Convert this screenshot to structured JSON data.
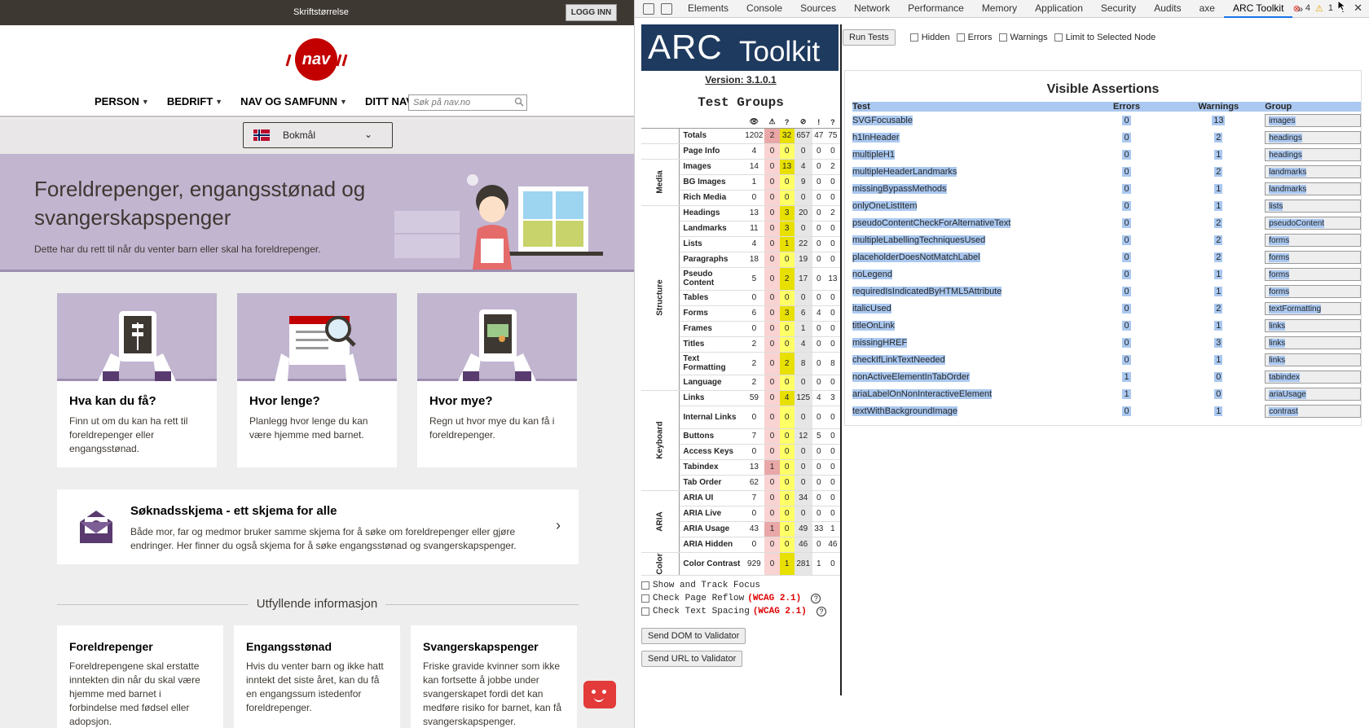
{
  "site": {
    "topbar": {
      "fontsize_label": "Skriftstørrelse",
      "login_label": "LOGG INN"
    },
    "menu": [
      {
        "label": "PERSON"
      },
      {
        "label": "BEDRIFT"
      },
      {
        "label": "NAV OG SAMFUNN"
      },
      {
        "label": "DITT NAV"
      }
    ],
    "search_placeholder": "Søk på nav.no",
    "language": "Bokmål",
    "hero": {
      "title": "Foreldrepenger, engangsstønad og svangerskapspenger",
      "subtitle": "Dette har du rett til når du venter barn eller skal ha foreldrepenger."
    },
    "cards": [
      {
        "title": "Hva kan du få?",
        "text": "Finn ut om du kan ha rett til foreldrepenger eller engangsstønad."
      },
      {
        "title": "Hvor lenge?",
        "text": "Planlegg hvor lenge du kan være hjemme med barnet."
      },
      {
        "title": "Hvor mye?",
        "text": "Regn ut hvor mye du kan få i foreldrepenger."
      }
    ],
    "form_card": {
      "title": "Søknadsskjema - ett skjema for alle",
      "text": "Både mor, far og medmor bruker samme skjema for å søke om foreldrepenger eller gjøre endringer. Her finner du også skjema for å søke engangsstønad og svangerskapspenger."
    },
    "more_info_heading": "Utfyllende informasjon",
    "info_cards": [
      {
        "title": "Foreldrepenger",
        "text": "Foreldrepengene skal erstatte inntekten din når du skal være hjemme med barnet i forbindelse med fødsel eller adopsjon."
      },
      {
        "title": "Engangsstønad",
        "text": "Hvis du venter barn og ikke hatt inntekt det siste året, kan du få en engangssum istedenfor foreldrepenger."
      },
      {
        "title": "Svangerskapspenger",
        "text": "Friske gravide kvinner som ikke kan fortsette å jobbe under svangerskapet fordi det kan medføre risiko for barnet, kan få svangerskapspenger."
      }
    ]
  },
  "devtools": {
    "tabs": [
      "Elements",
      "Console",
      "Sources",
      "Network",
      "Performance",
      "Memory",
      "Application",
      "Security",
      "Audits",
      "axe",
      "ARC Toolkit"
    ],
    "active_tab": "ARC Toolkit",
    "more_tabs": "»",
    "error_count": "4",
    "warning_count": "1",
    "error_icon": "x-circle-icon",
    "warning_icon": "warning-triangle-icon"
  },
  "arc": {
    "banner_arc": "ARC",
    "banner_toolkit": "Toolkit",
    "version": "Version: 3.1.0.1",
    "test_groups_title": "Test Groups",
    "header_icons": [
      "eye-icon",
      "alert-icon",
      "question-icon",
      "hidden-eye-icon",
      "exclamation-icon",
      "help-icon"
    ],
    "header_glyphs": [
      "👁",
      "⚠",
      "?",
      "⊘",
      "!",
      "?"
    ],
    "totals": {
      "name": "Totals",
      "values": [
        "1202",
        "2",
        "32",
        "657",
        "47",
        "75"
      ]
    },
    "page_info": {
      "name": "Page Info",
      "values": [
        "4",
        "0",
        "0",
        "0",
        "0",
        "0"
      ]
    },
    "groups": [
      {
        "group": "Media",
        "rows": [
          {
            "name": "Images",
            "values": [
              "14",
              "0",
              "13",
              "4",
              "0",
              "2"
            ]
          },
          {
            "name": "BG Images",
            "values": [
              "1",
              "0",
              "0",
              "9",
              "0",
              "0"
            ]
          },
          {
            "name": "Rich Media",
            "values": [
              "0",
              "0",
              "0",
              "0",
              "0",
              "0"
            ]
          }
        ]
      },
      {
        "group": "Structure",
        "rows": [
          {
            "name": "Headings",
            "values": [
              "13",
              "0",
              "3",
              "20",
              "0",
              "2"
            ]
          },
          {
            "name": "Landmarks",
            "values": [
              "11",
              "0",
              "3",
              "0",
              "0",
              "0"
            ]
          },
          {
            "name": "Lists",
            "values": [
              "4",
              "0",
              "1",
              "22",
              "0",
              "0"
            ]
          },
          {
            "name": "Paragraphs",
            "values": [
              "18",
              "0",
              "0",
              "19",
              "0",
              "0"
            ]
          },
          {
            "name": "Pseudo Content",
            "values": [
              "5",
              "0",
              "2",
              "17",
              "0",
              "13"
            ]
          },
          {
            "name": "Tables",
            "values": [
              "0",
              "0",
              "0",
              "0",
              "0",
              "0"
            ]
          },
          {
            "name": "Forms",
            "values": [
              "6",
              "0",
              "3",
              "6",
              "4",
              "0"
            ]
          },
          {
            "name": "Frames",
            "values": [
              "0",
              "0",
              "0",
              "1",
              "0",
              "0"
            ]
          },
          {
            "name": "Titles",
            "values": [
              "2",
              "0",
              "0",
              "4",
              "0",
              "0"
            ]
          },
          {
            "name": "Text Formatting",
            "values": [
              "2",
              "0",
              "2",
              "8",
              "0",
              "8"
            ]
          },
          {
            "name": "Language",
            "values": [
              "2",
              "0",
              "0",
              "0",
              "0",
              "0"
            ]
          }
        ]
      },
      {
        "group": "Keyboard",
        "rows": [
          {
            "name": "Links",
            "values": [
              "59",
              "0",
              "4",
              "125",
              "4",
              "3"
            ]
          },
          {
            "name": "Internal Links",
            "values": [
              "0",
              "0",
              "0",
              "0",
              "0",
              "0"
            ]
          },
          {
            "name": "Buttons",
            "values": [
              "7",
              "0",
              "0",
              "12",
              "5",
              "0"
            ]
          },
          {
            "name": "Access Keys",
            "values": [
              "0",
              "0",
              "0",
              "0",
              "0",
              "0"
            ]
          },
          {
            "name": "Tabindex",
            "values": [
              "13",
              "1",
              "0",
              "0",
              "0",
              "0"
            ]
          },
          {
            "name": "Tab Order",
            "values": [
              "62",
              "0",
              "0",
              "0",
              "0",
              "0"
            ]
          }
        ]
      },
      {
        "group": "ARIA",
        "rows": [
          {
            "name": "ARIA UI",
            "values": [
              "7",
              "0",
              "0",
              "34",
              "0",
              "0"
            ]
          },
          {
            "name": "ARIA Live",
            "values": [
              "0",
              "0",
              "0",
              "0",
              "0",
              "0"
            ]
          },
          {
            "name": "ARIA Usage",
            "values": [
              "43",
              "1",
              "0",
              "49",
              "33",
              "1"
            ]
          },
          {
            "name": "ARIA Hidden",
            "values": [
              "0",
              "0",
              "0",
              "46",
              "0",
              "46"
            ]
          }
        ]
      },
      {
        "group": "Color",
        "rows": [
          {
            "name": "Color Contrast",
            "values": [
              "929",
              "0",
              "1",
              "281",
              "1",
              "0"
            ]
          }
        ]
      }
    ],
    "options": [
      {
        "label": "Show and Track Focus",
        "wcag": "",
        "help": ""
      },
      {
        "label": "Check Page Reflow",
        "wcag": "(WCAG 2.1)",
        "help": "?"
      },
      {
        "label": "Check Text Spacing",
        "wcag": "(WCAG 2.1)",
        "help": "?"
      }
    ],
    "send_dom": "Send DOM to Validator",
    "send_url": "Send URL to Validator",
    "toolbar": {
      "run": "Run Tests",
      "filters": [
        "Hidden",
        "Errors",
        "Warnings",
        "Limit to Selected Node"
      ]
    },
    "assertions": {
      "title": "Visible Assertions",
      "columns": {
        "test": "Test",
        "errors": "Errors",
        "warnings": "Warnings",
        "group": "Group"
      },
      "rows": [
        {
          "test": "SVGFocusable",
          "errors": "0",
          "warnings": "13",
          "group": "images"
        },
        {
          "test": "h1InHeader",
          "errors": "0",
          "warnings": "2",
          "group": "headings"
        },
        {
          "test": "multipleH1",
          "errors": "0",
          "warnings": "1",
          "group": "headings"
        },
        {
          "test": "multipleHeaderLandmarks",
          "errors": "0",
          "warnings": "2",
          "group": "landmarks"
        },
        {
          "test": "missingBypassMethods",
          "errors": "0",
          "warnings": "1",
          "group": "landmarks"
        },
        {
          "test": "onlyOneListItem",
          "errors": "0",
          "warnings": "1",
          "group": "lists"
        },
        {
          "test": "pseudoContentCheckForAlternativeText",
          "errors": "0",
          "warnings": "2",
          "group": "pseudoContent"
        },
        {
          "test": "multipleLabellingTechniquesUsed",
          "errors": "0",
          "warnings": "2",
          "group": "forms"
        },
        {
          "test": "placeholderDoesNotMatchLabel",
          "errors": "0",
          "warnings": "2",
          "group": "forms"
        },
        {
          "test": "noLegend",
          "errors": "0",
          "warnings": "1",
          "group": "forms"
        },
        {
          "test": "requiredIsIndicatedByHTML5Attribute",
          "errors": "0",
          "warnings": "1",
          "group": "forms"
        },
        {
          "test": "italicUsed",
          "errors": "0",
          "warnings": "2",
          "group": "textFormatting"
        },
        {
          "test": "titleOnLink",
          "errors": "0",
          "warnings": "1",
          "group": "links"
        },
        {
          "test": "missingHREF",
          "errors": "0",
          "warnings": "3",
          "group": "links"
        },
        {
          "test": "checkIfLinkTextNeeded",
          "errors": "0",
          "warnings": "1",
          "group": "links"
        },
        {
          "test": "nonActiveElementInTabOrder",
          "errors": "1",
          "warnings": "0",
          "group": "tabindex"
        },
        {
          "test": "ariaLabelOnNonInteractiveElement",
          "errors": "1",
          "warnings": "0",
          "group": "ariaUsage"
        },
        {
          "test": "textWithBackgroundImage",
          "errors": "0",
          "warnings": "1",
          "group": "contrast"
        }
      ]
    }
  }
}
